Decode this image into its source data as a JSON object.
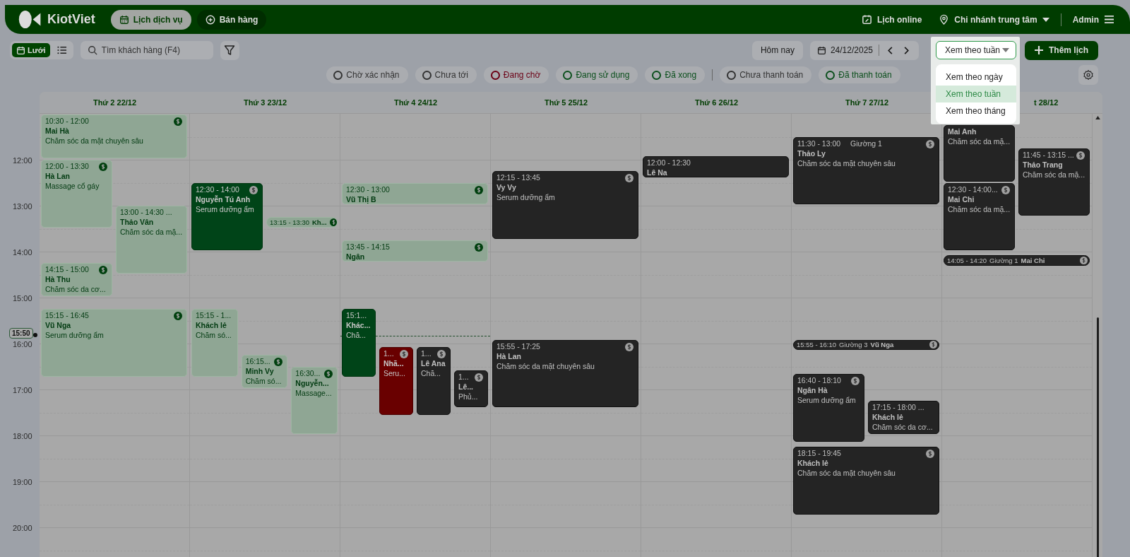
{
  "nav": {
    "brand": "KiotViet",
    "tabs": [
      {
        "label": "Lịch dịch vụ",
        "selected": true
      },
      {
        "label": "Bán hàng",
        "selected": false
      }
    ],
    "online": "Lịch online",
    "branch": "Chi nhánh trung tâm",
    "user": "Admin"
  },
  "toolbar": {
    "views": [
      {
        "label": "Lưới",
        "selected": true
      },
      {
        "selected": false
      }
    ],
    "search": {
      "placeholder": "Tìm khách hàng (F4)"
    },
    "today": "Hôm nay",
    "date": "24/12/2025",
    "view_select": {
      "value": "Xem theo tuần",
      "expanded": true,
      "options": [
        {
          "label": "Xem theo ngày",
          "selected": false
        },
        {
          "label": "Xem theo tuần",
          "selected": true
        },
        {
          "label": "Xem theo tháng",
          "selected": false
        }
      ]
    },
    "add": "Thêm lịch"
  },
  "filters": [
    {
      "label": "Chờ xác nhận",
      "color": "#333333"
    },
    {
      "label": "Chưa tới",
      "color": "#333333"
    },
    {
      "label": "Đang chờ",
      "color": "#6b0015"
    },
    {
      "label": "Đang sử dụng",
      "color": "#0b4f1c"
    },
    {
      "label": "Đã xong",
      "color": "#0b4f1c"
    },
    {
      "label": "Chưa thanh toán",
      "color": "#333333"
    },
    {
      "label": "Đã thanh toán",
      "color": "#0b4f1c"
    }
  ],
  "hours": [
    "12:00",
    "13:00",
    "14:00",
    "15:00",
    "16:00",
    "17:00",
    "18:00",
    "19:00",
    "20:00"
  ],
  "now": {
    "label": "15:50"
  },
  "days": [
    {
      "label": "Thứ 2 22/12",
      "events": [
        {
          "kind": "booked",
          "paid": true,
          "time": "10:30 - 12:00",
          "name": "Mai Hà",
          "service": "Chăm sóc da mặt chuyên sâu"
        },
        {
          "kind": "booked",
          "paid": true,
          "time": "12:00 - 13:30",
          "name": "Hà Lan",
          "service": "Massage cổ gáy"
        },
        {
          "kind": "booked",
          "paid": false,
          "time": "13:00 - 14:30 ...",
          "name": "Thảo Vân",
          "service": "Chăm sóc da mặ..."
        },
        {
          "kind": "booked",
          "paid": true,
          "time": "14:15 - 15:00",
          "name": "Hà Thu",
          "service": "Chăm sóc da cơ..."
        },
        {
          "kind": "booked",
          "paid": true,
          "time": "15:15 - 16:45",
          "name": "Vũ Nga",
          "service": "Serum dưỡng ẩm"
        }
      ]
    },
    {
      "label": "Thứ 3 23/12",
      "events": [
        {
          "kind": "active",
          "paid": true,
          "time": "12:30 - 14:00",
          "name": "Nguyễn Tú Anh",
          "service": "Serum dưỡng ẩm"
        },
        {
          "kind": "booked",
          "paid": true,
          "compact": true,
          "time": "13:15 - 13:30",
          "name": "Kh..."
        },
        {
          "kind": "booked",
          "paid": false,
          "time": "15:15 - 1...",
          "name": "Khách lẻ",
          "service": "Chăm só..."
        },
        {
          "kind": "booked",
          "paid": true,
          "time": "16:15...",
          "name": "Minh Vy",
          "service": "Chăm só..."
        },
        {
          "kind": "booked",
          "paid": true,
          "time": "16:30...",
          "name": "Nguyễn...",
          "service": "Massage..."
        }
      ]
    },
    {
      "label": "Thứ 4 24/12",
      "events": [
        {
          "kind": "booked",
          "paid": true,
          "time": "12:30 - 13:00",
          "name": "Vũ Thị B"
        },
        {
          "kind": "booked",
          "paid": true,
          "time": "13:45 - 14:15",
          "name": "Ngân"
        },
        {
          "kind": "active",
          "paid": false,
          "time": "15:1...",
          "name": "Khác...",
          "service": "Chă..."
        },
        {
          "kind": "waiting",
          "paid": true,
          "time": "1...",
          "name": "Nhã...",
          "service": "Seru..."
        },
        {
          "kind": "done",
          "paid": true,
          "time": "1...",
          "name": "Lê Ana",
          "service": "Chă..."
        },
        {
          "kind": "done",
          "paid": true,
          "time": "1...",
          "name": "Lê...",
          "service": "Phủ..."
        }
      ]
    },
    {
      "label": "Thứ 5 25/12",
      "events": [
        {
          "kind": "done",
          "paid": true,
          "time": "12:15 - 13:45",
          "name": "Vy Vy",
          "service": "Serum dưỡng ẩm"
        },
        {
          "kind": "done",
          "paid": true,
          "time": "15:55 - 17:25",
          "name": "Hà Lan",
          "service": "Chăm sóc da mặt chuyên sâu"
        }
      ]
    },
    {
      "label": "Thứ 6 26/12",
      "events": [
        {
          "kind": "done",
          "paid": false,
          "time": "12:00 - 12:30",
          "name": "Lê Na"
        }
      ]
    },
    {
      "label": "Thứ 7 27/12",
      "events": [
        {
          "kind": "done",
          "paid": true,
          "time": "11:30 - 13:00",
          "bed": "Giường 1",
          "name": "Thảo Ly",
          "service": "Chăm sóc da mặt chuyên sâu"
        },
        {
          "kind": "done",
          "paid": true,
          "compact": true,
          "time": "15:55 - 16:10",
          "bed": "Giường 3",
          "name": "Vũ Nga"
        },
        {
          "kind": "done",
          "paid": true,
          "time": "16:40 - 18:10",
          "name": "Ngân Hà",
          "service": "Serum dưỡng ẩm"
        },
        {
          "kind": "done",
          "paid": false,
          "time": "17:15 - 18:00 ...",
          "name": "Khách lẻ",
          "service": "Chăm sóc da cơ..."
        },
        {
          "kind": "done",
          "paid": true,
          "time": "18:15 - 19:45",
          "name": "Khách lẻ",
          "service": "Chăm sóc da mặt chuyên sâu"
        }
      ]
    },
    {
      "label": "t 28/12",
      "events": [
        {
          "kind": "done",
          "paid": false,
          "name": "Mai Anh",
          "service": "Chăm sóc da mặ..."
        },
        {
          "kind": "done",
          "paid": true,
          "time": "11:45 - 13:15 ...",
          "name": "Thảo Trang",
          "service": "Chăm sóc da mặ..."
        },
        {
          "kind": "done",
          "paid": true,
          "time": "12:30 - 14:00...",
          "name": "Mai Chi",
          "service": "Chăm sóc da mặ..."
        },
        {
          "kind": "done",
          "paid": true,
          "compact": true,
          "time": "14:05 - 14:20",
          "bed": "Giường 1",
          "name": "Mai Chi"
        }
      ]
    }
  ]
}
